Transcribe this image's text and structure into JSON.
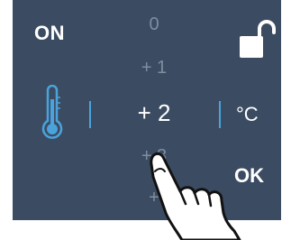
{
  "panel": {
    "power_label": "ON",
    "confirm_label": "OK",
    "unit": "°C",
    "selected_value": "+ 2",
    "values": [
      "0",
      "+ 1",
      "+ 2",
      "+ 3",
      "+"
    ]
  },
  "icons": {
    "lock": "unlocked-padlock-icon",
    "thermometer": "thermometer-icon",
    "hand": "pointing-hand-icon"
  },
  "colors": {
    "panel_bg": "#3b4c62",
    "accent": "#4aa3dc",
    "text": "#ffffff",
    "dim_text": "#7f8da0"
  }
}
